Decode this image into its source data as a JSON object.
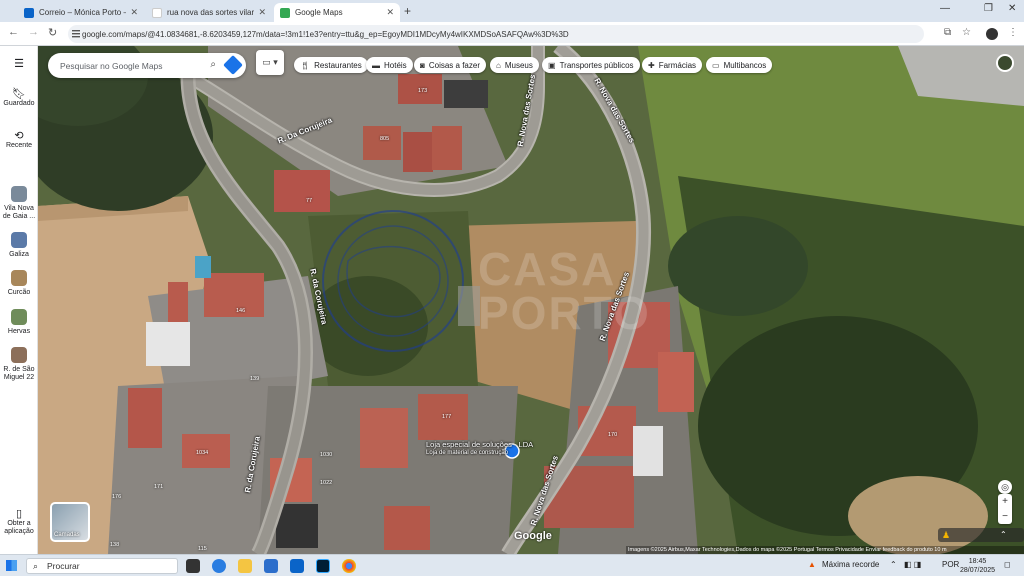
{
  "browser": {
    "tabs": [
      {
        "title": "Correio – Mónica Porto – Outlo",
        "active": false,
        "icon": "outlook-icon"
      },
      {
        "title": "rua nova das sortes vilar do pa",
        "active": false,
        "icon": "google-icon"
      },
      {
        "title": "Google Maps",
        "active": true,
        "icon": "maps-icon"
      }
    ],
    "new_tab": "+",
    "url": "google.com/maps/@41.0834681,-8.6203459,127m/data=!3m1!1e3?entry=ttu&g_ep=EgoyMDI1MDcyMy4wIKXMDSoASAFQAw%3D%3D"
  },
  "maps": {
    "search_placeholder": "Pesquisar no Google Maps",
    "chips": [
      {
        "icon": "restaurant-icon",
        "label": "Restaurantes"
      },
      {
        "icon": "hotel-icon",
        "label": "Hotéis"
      },
      {
        "icon": "camera-icon",
        "label": "Coisas a fazer"
      },
      {
        "icon": "museum-icon",
        "label": "Museus"
      },
      {
        "icon": "transit-icon",
        "label": "Transportes públicos"
      },
      {
        "icon": "pharmacy-icon",
        "label": "Farmácias"
      },
      {
        "icon": "atm-icon",
        "label": "Multibancos"
      }
    ],
    "rail": {
      "saved": "Guardado",
      "recent": "Recente",
      "recents": [
        {
          "label": "Vila Nova de Gaia ...",
          "color": "#7a8a9a"
        },
        {
          "label": "Galiza",
          "color": "#5b7aa8"
        },
        {
          "label": "Curcão",
          "color": "#a8875b"
        },
        {
          "label": "Hervas",
          "color": "#6f8c5a"
        },
        {
          "label": "R. de São Miguel 22",
          "color": "#8c6f5a"
        }
      ],
      "get_app": "Obter a aplicação"
    },
    "roads": {
      "r1": "R. Da Corujeira",
      "r2": "R. da Corujeira",
      "r3": "R. da Corujeira",
      "r4": "R. Nova das Sortes",
      "r5": "R. Nova das Sortes",
      "r6": "R. Nova das Sortes"
    },
    "house_numbers": [
      "173",
      "805",
      "146",
      "77",
      "177",
      "1034",
      "1030",
      "1022",
      "170",
      "171",
      "176",
      "138",
      "115",
      "139"
    ],
    "poi": {
      "name": "Loja especial de soluções - LDA",
      "subtitle": "Loja de material de construção"
    },
    "watermark": {
      "line1": "CASA",
      "line2": "PORTO"
    },
    "layers_label": "Camadas",
    "logo": "Google",
    "attribution": "Imagens ©2025 Airbus,Maxar Technologies,Dados do mapa ©2025   Portugal   Termos   Privacidade   Enviar feedback do produto   10 m"
  },
  "taskbar": {
    "search": "Procurar",
    "weather": "Máxima recorde",
    "lang": "POR",
    "time": "18:45",
    "date": "28/07/2025"
  }
}
